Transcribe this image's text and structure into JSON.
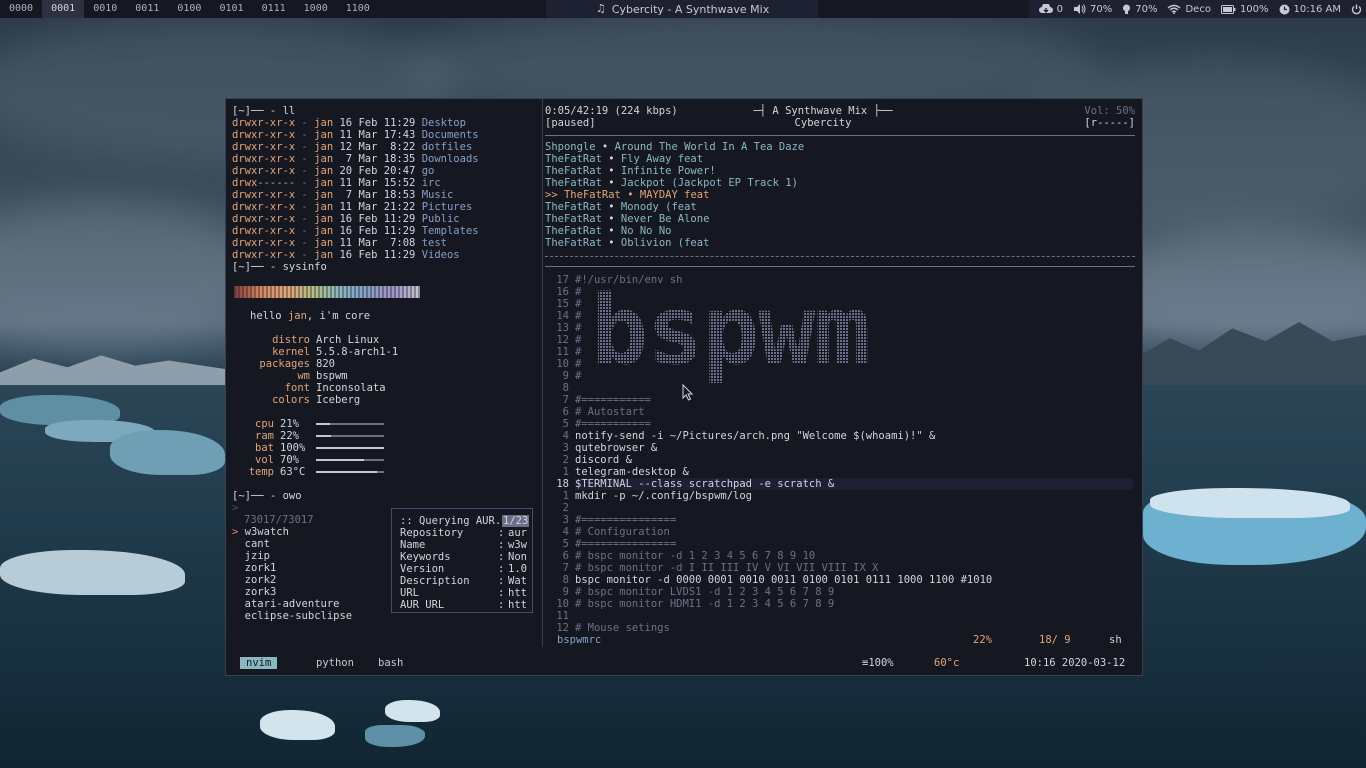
{
  "colors": {
    "bg": "#161821",
    "fg": "#c6c8d1",
    "blue": "#84a0c6",
    "orange": "#e2a478",
    "red": "#e27878",
    "green": "#b4be82",
    "cyan": "#89b8c2",
    "purple": "#a093c7"
  },
  "bar": {
    "workspaces": [
      "0000",
      "0001",
      "0010",
      "0011",
      "0100",
      "0101",
      "0111",
      "1000",
      "1100"
    ],
    "active_workspace": "0001",
    "title_icon": "music-note-icon",
    "title": "Cybercity - A Synthwave Mix",
    "updates": "0",
    "volume": "70%",
    "brightness": "70%",
    "wifi": "Deco",
    "battery": "100%",
    "clock": "10:16 AM"
  },
  "left": {
    "prompt_ls": "[~]── - ll",
    "ls": [
      {
        "perm": "drwxr-xr-x",
        "user": "jan",
        "day": "16",
        "mon": "Feb",
        "time": "11:29",
        "name": "Desktop"
      },
      {
        "perm": "drwxr-xr-x",
        "user": "jan",
        "day": "11",
        "mon": "Mar",
        "time": "17:43",
        "name": "Documents"
      },
      {
        "perm": "drwxr-xr-x",
        "user": "jan",
        "day": "12",
        "mon": "Mar",
        "time": " 8:22",
        "name": "dotfiles"
      },
      {
        "perm": "drwxr-xr-x",
        "user": "jan",
        "day": " 7",
        "mon": "Mar",
        "time": "18:35",
        "name": "Downloads"
      },
      {
        "perm": "drwxr-xr-x",
        "user": "jan",
        "day": "20",
        "mon": "Feb",
        "time": "20:47",
        "name": "go"
      },
      {
        "perm": "drwx------",
        "user": "jan",
        "day": "11",
        "mon": "Mar",
        "time": "15:52",
        "name": "irc"
      },
      {
        "perm": "drwxr-xr-x",
        "user": "jan",
        "day": " 7",
        "mon": "Mar",
        "time": "18:53",
        "name": "Music"
      },
      {
        "perm": "drwxr-xr-x",
        "user": "jan",
        "day": "11",
        "mon": "Mar",
        "time": "21:22",
        "name": "Pictures"
      },
      {
        "perm": "drwxr-xr-x",
        "user": "jan",
        "day": "16",
        "mon": "Feb",
        "time": "11:29",
        "name": "Public"
      },
      {
        "perm": "drwxr-xr-x",
        "user": "jan",
        "day": "16",
        "mon": "Feb",
        "time": "11:29",
        "name": "Templates"
      },
      {
        "perm": "drwxr-xr-x",
        "user": "jan",
        "day": "11",
        "mon": "Mar",
        "time": " 7:08",
        "name": "test"
      },
      {
        "perm": "drwxr-xr-x",
        "user": "jan",
        "day": "16",
        "mon": "Feb",
        "time": "11:29",
        "name": "Videos"
      }
    ],
    "prompt_sysinfo": "[~]── - sysinfo",
    "hello": "hello",
    "hello_user": "jan",
    "hello_rest": ", i'm core",
    "info": [
      {
        "k": "distro",
        "v": "Arch Linux"
      },
      {
        "k": "kernel",
        "v": "5.5.8-arch1-1"
      },
      {
        "k": "packages",
        "v": "820"
      },
      {
        "k": "wm",
        "v": "bspwm"
      },
      {
        "k": "font",
        "v": "Inconsolata"
      },
      {
        "k": "colors",
        "v": "Iceberg"
      }
    ],
    "stats": [
      {
        "k": "cpu",
        "v": "21%",
        "level": 0.21
      },
      {
        "k": "ram",
        "v": "22%",
        "level": 0.22
      },
      {
        "k": "bat",
        "v": "100%",
        "level": 1.0
      },
      {
        "k": "vol",
        "v": "70%",
        "level": 0.7
      },
      {
        "k": "temp",
        "v": "63°C",
        "level": 0.9
      }
    ],
    "prompt_owo": "[~]── - owo",
    "input_marker": ">",
    "count": "73017/73017",
    "selected_marker": ">",
    "results": [
      "w3watch",
      "cant",
      "jzip",
      "zork1",
      "zork2",
      "zork3",
      "atari-adventure",
      "eclipse-subclipse"
    ],
    "popup": {
      "header": ":: Querying AUR..",
      "badge": "1/23",
      "rows": [
        {
          "k": "Repository",
          "v": "aur"
        },
        {
          "k": "Name",
          "v": "w3w"
        },
        {
          "k": "Keywords",
          "v": "Non"
        },
        {
          "k": "Version",
          "v": "1.0"
        },
        {
          "k": "Description",
          "v": "Wat"
        },
        {
          "k": "URL",
          "v": "htt"
        },
        {
          "k": "AUR URL",
          "v": "htt"
        }
      ]
    }
  },
  "music": {
    "time": "0:05/42:19 (224 kbps)",
    "state": "[paused]",
    "album": "A Synthwave Mix",
    "album_deco_left": "─┤",
    "album_deco_right": "├──",
    "artist": "Cybercity",
    "vol": "Vol: 50%",
    "flags": "[r-----]",
    "playlist": [
      {
        "artist": "Shpongle",
        "title": "Around The World In A Tea Daze",
        "current": false
      },
      {
        "artist": "TheFatRat",
        "title": "Fly Away feat",
        "current": false
      },
      {
        "artist": "TheFatRat",
        "title": "Infinite Power!",
        "current": false
      },
      {
        "artist": "TheFatRat",
        "title": "Jackpot (Jackpot EP Track 1)",
        "current": false
      },
      {
        "artist": "TheFatRat",
        "title": "MAYDAY feat",
        "current": true
      },
      {
        "artist": "TheFatRat",
        "title": "Monody (feat",
        "current": false
      },
      {
        "artist": "TheFatRat",
        "title": "Never Be Alone",
        "current": false
      },
      {
        "artist": "TheFatRat",
        "title": "No No No",
        "current": false
      },
      {
        "artist": "TheFatRat",
        "title": "Oblivion (feat",
        "current": false
      }
    ],
    "bullet": "•",
    "current_marker": ">>"
  },
  "editor": {
    "lines": [
      {
        "n": "17",
        "t": "#!/usr/bin/env sh",
        "c": "grey"
      },
      {
        "n": "16",
        "t": "#",
        "c": "grey"
      },
      {
        "n": "15",
        "t": "#",
        "c": "grey"
      },
      {
        "n": "14",
        "t": "#",
        "c": "grey"
      },
      {
        "n": "13",
        "t": "#",
        "c": "grey"
      },
      {
        "n": "12",
        "t": "#",
        "c": "grey"
      },
      {
        "n": "11",
        "t": "#",
        "c": "grey"
      },
      {
        "n": "10",
        "t": "#",
        "c": "grey"
      },
      {
        "n": "9",
        "t": "#",
        "c": "grey"
      },
      {
        "n": "8",
        "t": "",
        "c": "grey"
      },
      {
        "n": "7",
        "t": "#===========",
        "c": "grey"
      },
      {
        "n": "6",
        "t": "# Autostart",
        "c": "grey"
      },
      {
        "n": "5",
        "t": "#===========",
        "c": "grey"
      },
      {
        "n": "4",
        "t": "notify-send -i ~/Pictures/arch.png \"Welcome $(whoami)!\" &",
        "c": "white"
      },
      {
        "n": "3",
        "t": "qutebrowser &",
        "c": "white"
      },
      {
        "n": "2",
        "t": "discord &",
        "c": "white"
      },
      {
        "n": "1",
        "t": "telegram-desktop &",
        "c": "white"
      },
      {
        "n": "18",
        "t": "$TERMINAL --class scratchpad -e scratch &",
        "c": "white"
      },
      {
        "n": "1",
        "t": "mkdir -p ~/.config/bspwm/log",
        "c": "white"
      },
      {
        "n": "2",
        "t": "",
        "c": "grey"
      },
      {
        "n": "3",
        "t": "#===============",
        "c": "grey"
      },
      {
        "n": "4",
        "t": "# Configuration",
        "c": "grey"
      },
      {
        "n": "5",
        "t": "#===============",
        "c": "grey"
      },
      {
        "n": "6",
        "t": "# bspc monitor -d 1 2 3 4 5 6 7 8 9 10",
        "c": "grey"
      },
      {
        "n": "7",
        "t": "# bspc monitor -d I II III IV V VI VII VIII IX X",
        "c": "grey"
      },
      {
        "n": "8",
        "t": "bspc monitor -d 0000 0001 0010 0011 0100 0101 0111 1000 1100 #1010",
        "c": "white"
      },
      {
        "n": "9",
        "t": "# bspc monitor LVDS1 -d 1 2 3 4 5 6 7 8 9",
        "c": "grey"
      },
      {
        "n": "10",
        "t": "# bspc monitor HDMI1 -d 1 2 3 4 5 6 7 8 9",
        "c": "grey"
      },
      {
        "n": "11",
        "t": "",
        "c": "grey"
      },
      {
        "n": "12",
        "t": "# Mouse setings",
        "c": "grey"
      }
    ],
    "logo": "bspwm",
    "filename": "bspwmrc",
    "percent": "22%",
    "position": "18/ 9",
    "filetype": "sh"
  },
  "status": {
    "tabs": [
      "nvim",
      "python",
      "bash"
    ],
    "active_tab": "nvim",
    "zoom": "≡100%",
    "temp": "60°c",
    "datetime": "10:16 2020-03-12"
  }
}
